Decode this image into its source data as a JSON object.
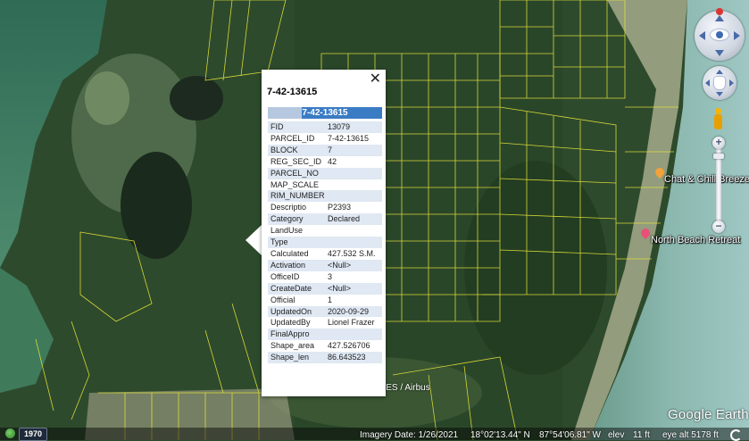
{
  "map": {
    "places": [
      {
        "label": "Chat & Chill Breeze",
        "pin_color": "#f2a23a"
      },
      {
        "label": "North Beach Retreat",
        "pin_color": "#e8507a"
      }
    ],
    "copyright": "NES / Airbus"
  },
  "popup": {
    "title": "7-42-13615",
    "header": "7-42-13615",
    "rows": [
      {
        "key": "FID",
        "value": "13079"
      },
      {
        "key": "PARCEL_ID",
        "value": "7-42-13615"
      },
      {
        "key": "BLOCK",
        "value": "7"
      },
      {
        "key": "REG_SEC_ID",
        "value": "42"
      },
      {
        "key": "PARCEL_NO",
        "value": ""
      },
      {
        "key": "MAP_SCALE",
        "value": ""
      },
      {
        "key": "RIM_NUMBER",
        "value": ""
      },
      {
        "key": "Descriptio",
        "value": "P2393"
      },
      {
        "key": "Category",
        "value": "Declared"
      },
      {
        "key": "LandUse",
        "value": ""
      },
      {
        "key": "Type",
        "value": ""
      },
      {
        "key": "Calculated",
        "value": "427.532 S.M."
      },
      {
        "key": "Activation",
        "value": "<Null>"
      },
      {
        "key": "OfficeID",
        "value": "3"
      },
      {
        "key": "CreateDate",
        "value": "<Null>"
      },
      {
        "key": "Official",
        "value": "1"
      },
      {
        "key": "UpdatedOn",
        "value": "2020-09-29"
      },
      {
        "key": "UpdatedBy",
        "value": "Lionel Frazer"
      },
      {
        "key": "FinalAppro",
        "value": ""
      },
      {
        "key": "Shape_area",
        "value": "427.526706"
      },
      {
        "key": "Shape_len",
        "value": "86.643523"
      }
    ]
  },
  "controls": {
    "zoom_in": "+",
    "zoom_out": "−"
  },
  "status": {
    "year": "1970",
    "imagery_date": "Imagery Date: 1/26/2021",
    "lat": "18°02'13.44\" N",
    "lon": "87°54'06.81\" W",
    "elev_label": "elev",
    "elev_value": "11 ft",
    "eye_alt": "eye alt  5178 ft"
  },
  "brand": "Google Earth"
}
